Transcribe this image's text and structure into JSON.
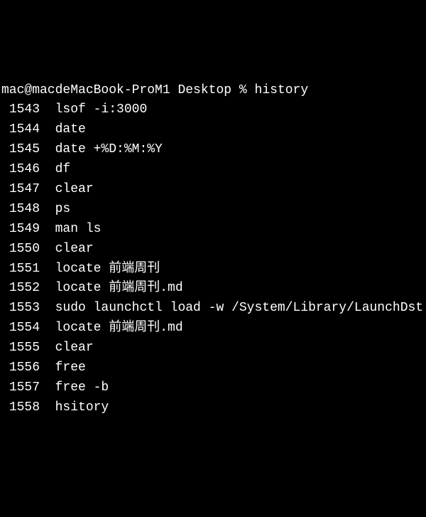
{
  "prompt": {
    "user_host": "mac@macdeMacBook-ProM1",
    "cwd": "Desktop",
    "symbol": "%",
    "command": "history"
  },
  "history": [
    {
      "num": "1543",
      "cmd": "lsof -i:3000"
    },
    {
      "num": "1544",
      "cmd": "date"
    },
    {
      "num": "1545",
      "cmd": "date +%D:%M:%Y"
    },
    {
      "num": "1546",
      "cmd": "df"
    },
    {
      "num": "1547",
      "cmd": "clear"
    },
    {
      "num": "1548",
      "cmd": "ps"
    },
    {
      "num": "1549",
      "cmd": "man ls"
    },
    {
      "num": "1550",
      "cmd": "clear"
    },
    {
      "num": "1551",
      "cmd": "locate 前端周刊"
    },
    {
      "num": "1552",
      "cmd": "locate 前端周刊.md"
    },
    {
      "num": "1553",
      "cmd": "sudo launchctl load -w /System/Library/LaunchDst"
    },
    {
      "num": "1554",
      "cmd": "locate 前端周刊.md"
    },
    {
      "num": "1555",
      "cmd": "clear"
    },
    {
      "num": "1556",
      "cmd": "free"
    },
    {
      "num": "1557",
      "cmd": "free -b"
    },
    {
      "num": "1558",
      "cmd": "hsitory"
    }
  ]
}
